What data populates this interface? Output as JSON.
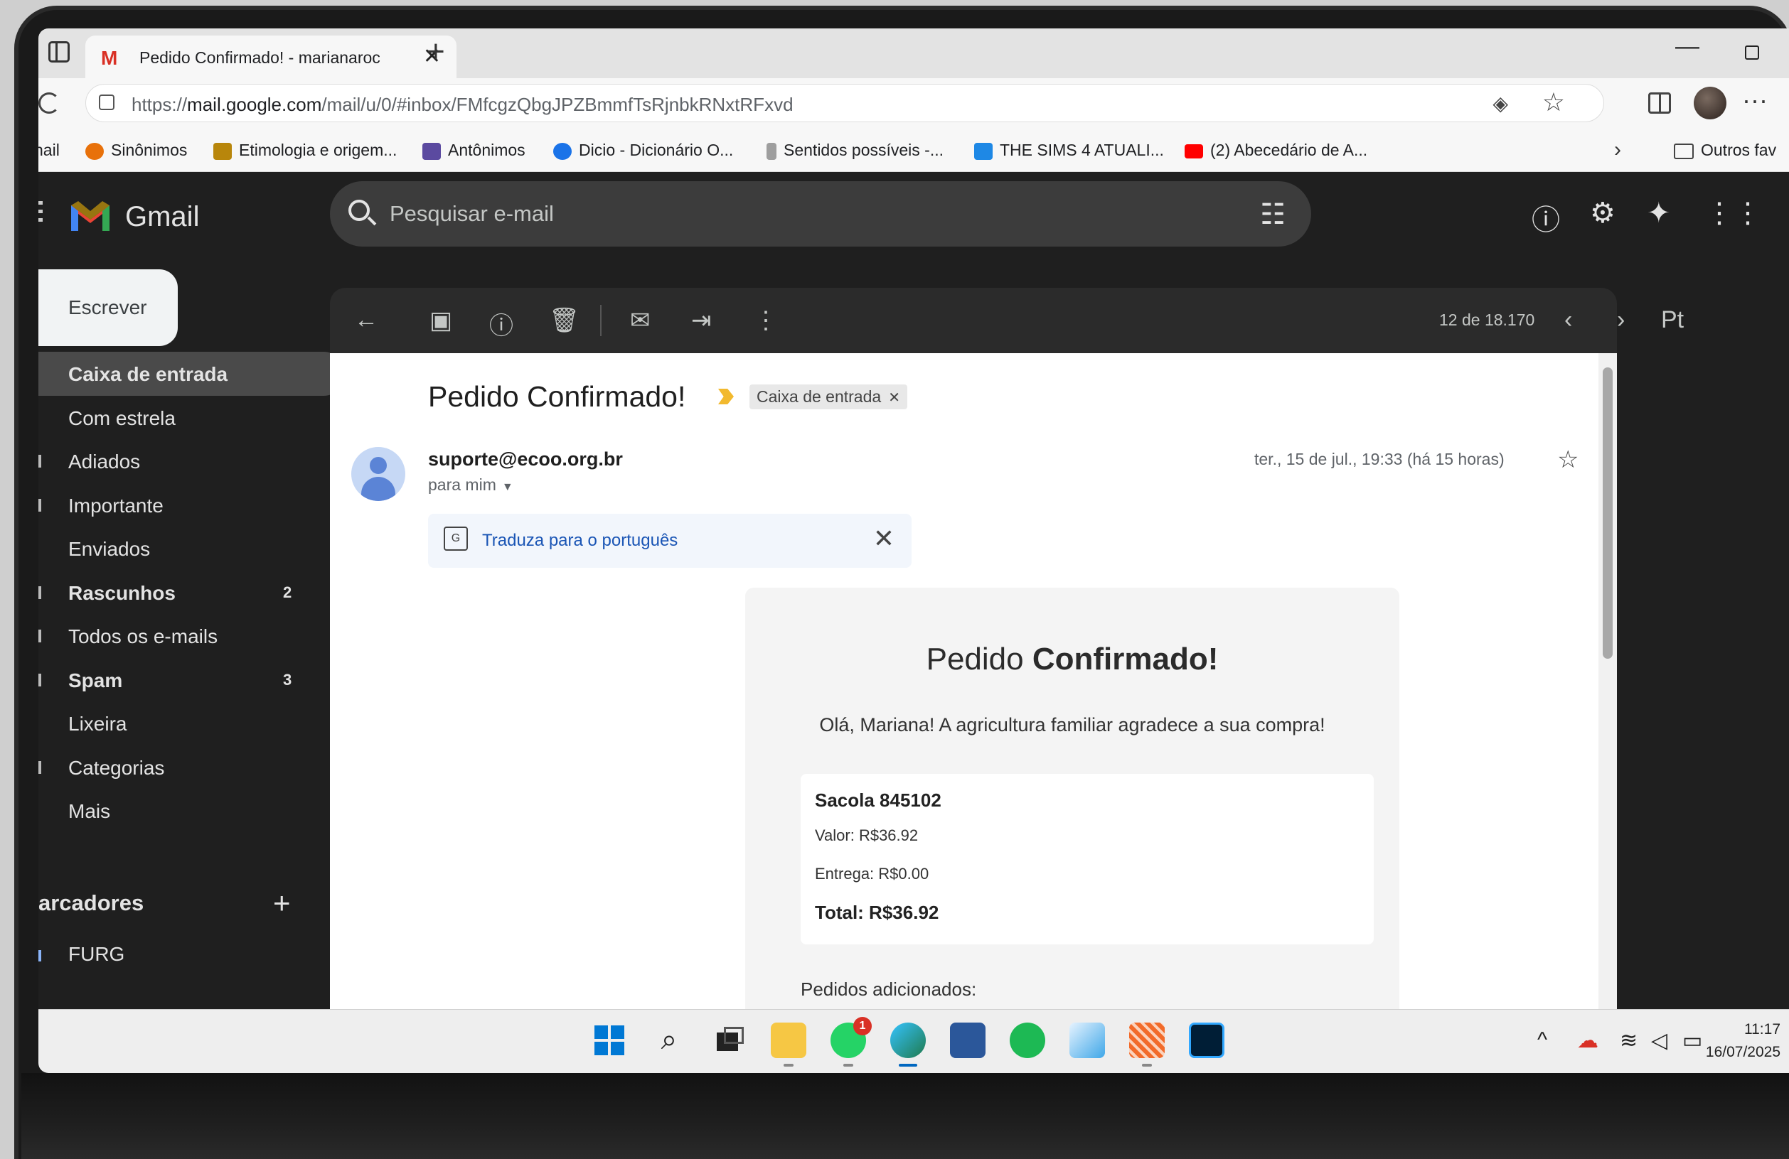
{
  "browser": {
    "tab_title": "Pedido Confirmado! - marianaroc",
    "url_prefix": "https://",
    "url_host": "mail.google.com",
    "url_path": "/mail/u/0/#inbox/FMfcgzQbgJPZBmmfTsRjnbkRNxtRFxvd",
    "bookmarks": [
      {
        "label": "nail",
        "color": "#ffffff"
      },
      {
        "label": "Sinônimos",
        "color": "#e8710a"
      },
      {
        "label": "Etimologia e origem...",
        "color": "#b8860b"
      },
      {
        "label": "Antônimos",
        "color": "#5b4aa0"
      },
      {
        "label": "Dicio - Dicionário O...",
        "color": "#1a73e8"
      },
      {
        "label": "Sentidos possíveis -...",
        "color": "#9e9e9e"
      },
      {
        "label": "THE SIMS 4 ATUALI...",
        "color": "#1e88e5"
      },
      {
        "label": "(2) Abecedário de A...",
        "color": "#ff0000"
      }
    ],
    "other_favorites": "Outros fav"
  },
  "gmail": {
    "brand": "Gmail",
    "search_placeholder": "Pesquisar e-mail",
    "compose_label": "Escrever",
    "nav": [
      {
        "label": "Caixa de entrada",
        "count": "",
        "active": true,
        "bold": true
      },
      {
        "label": "Com estrela",
        "count": "",
        "active": false,
        "bold": false
      },
      {
        "label": "Adiados",
        "count": "",
        "active": false,
        "bold": false
      },
      {
        "label": "Importante",
        "count": "",
        "active": false,
        "bold": false
      },
      {
        "label": "Enviados",
        "count": "",
        "active": false,
        "bold": false
      },
      {
        "label": "Rascunhos",
        "count": "2",
        "active": false,
        "bold": true
      },
      {
        "label": "Todos os e-mails",
        "count": "",
        "active": false,
        "bold": false
      },
      {
        "label": "Spam",
        "count": "3",
        "active": false,
        "bold": true
      },
      {
        "label": "Lixeira",
        "count": "",
        "active": false,
        "bold": false
      },
      {
        "label": "Categorias",
        "count": "",
        "active": false,
        "bold": false
      },
      {
        "label": "Mais",
        "count": "",
        "active": false,
        "bold": false
      }
    ],
    "labels_title": "arcadores",
    "labels": [
      "FURG"
    ],
    "toolbar_count": "12 de 18.170",
    "input_tools": "Pt"
  },
  "message": {
    "subject": "Pedido Confirmado!",
    "folder_chip": "Caixa de entrada",
    "sender": "suporte@ecoo.org.br",
    "recipient": "para mim",
    "datetime": "ter., 15 de jul., 19:33 (há 15 horas)",
    "translate_text": "Traduza para o português",
    "body_title_plain": "Pedido ",
    "body_title_bold": "Confirmado!",
    "greeting": "Olá, Mariana! A agricultura familiar agradece a sua compra!",
    "bag": "Sacola 845102",
    "value": "Valor: R$36.92",
    "delivery": "Entrega: R$0.00",
    "total": "Total: R$36.92",
    "added_orders": "Pedidos adicionados:"
  },
  "taskbar": {
    "whatsapp_badge": "1",
    "time": "11:17",
    "date": "16/07/2025"
  }
}
